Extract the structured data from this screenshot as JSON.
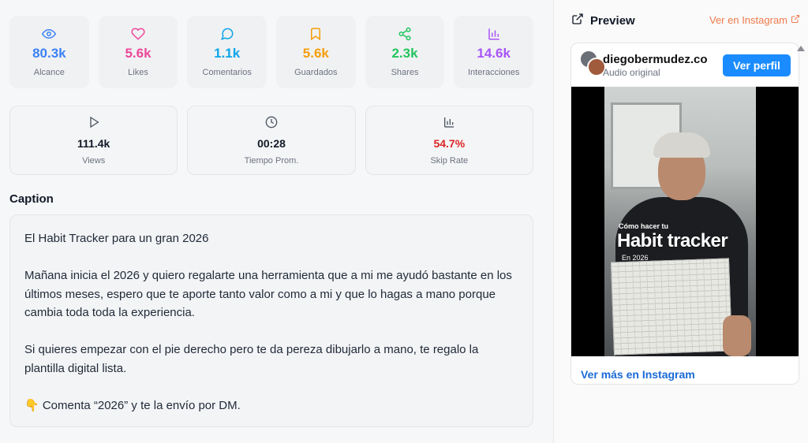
{
  "stats_primary": [
    {
      "icon": "eye-icon",
      "value": "80.3k",
      "label": "Alcance",
      "color": "#3b82f6"
    },
    {
      "icon": "heart-icon",
      "value": "5.6k",
      "label": "Likes",
      "color": "#ec4899"
    },
    {
      "icon": "comment-icon",
      "value": "1.1k",
      "label": "Comentarios",
      "color": "#0ea5e9"
    },
    {
      "icon": "bookmark-icon",
      "value": "5.6k",
      "label": "Guardados",
      "color": "#f59e0b"
    },
    {
      "icon": "share-icon",
      "value": "2.3k",
      "label": "Shares",
      "color": "#22c55e"
    },
    {
      "icon": "bar-chart-icon",
      "value": "14.6k",
      "label": "Interacciones",
      "color": "#a855f7"
    }
  ],
  "stats_secondary": [
    {
      "icon": "play-icon",
      "value": "111.4k",
      "label": "Views"
    },
    {
      "icon": "clock-icon",
      "value": "00:28",
      "label": "Tiempo Prom."
    },
    {
      "icon": "bar-chart-icon",
      "value": "54.7%",
      "label": "Skip Rate",
      "color": "#dc2626"
    }
  ],
  "caption": {
    "title": "Caption",
    "paragraphs": [
      "El Habit Tracker para un gran 2026",
      "Mañana inicia el 2026 y quiero regalarte una herramienta que a mi me ayudó bastante en los últimos meses, espero que te aporte tanto valor como a mi y que lo hagas a mano porque cambia toda toda la experiencia.",
      "Si quieres empezar con el pie derecho pero te da pereza dibujarlo a mano, te regalo la plantilla digital lista.",
      "👇 Comenta “2026” y te la envío por DM."
    ]
  },
  "preview": {
    "title": "Preview",
    "instagram_link": "Ver en Instagram",
    "username": "diegobermudez.co",
    "audio": "Audio original",
    "profile_button": "Ver perfil",
    "more_link": "Ver más en Instagram",
    "video_overlay": {
      "small": "Cómo hacer tu",
      "big": "Habit tracker",
      "year": "En 2026"
    }
  },
  "colors": {
    "accent_orange": "#f07a4a",
    "instagram_blue": "#1a8cff"
  }
}
